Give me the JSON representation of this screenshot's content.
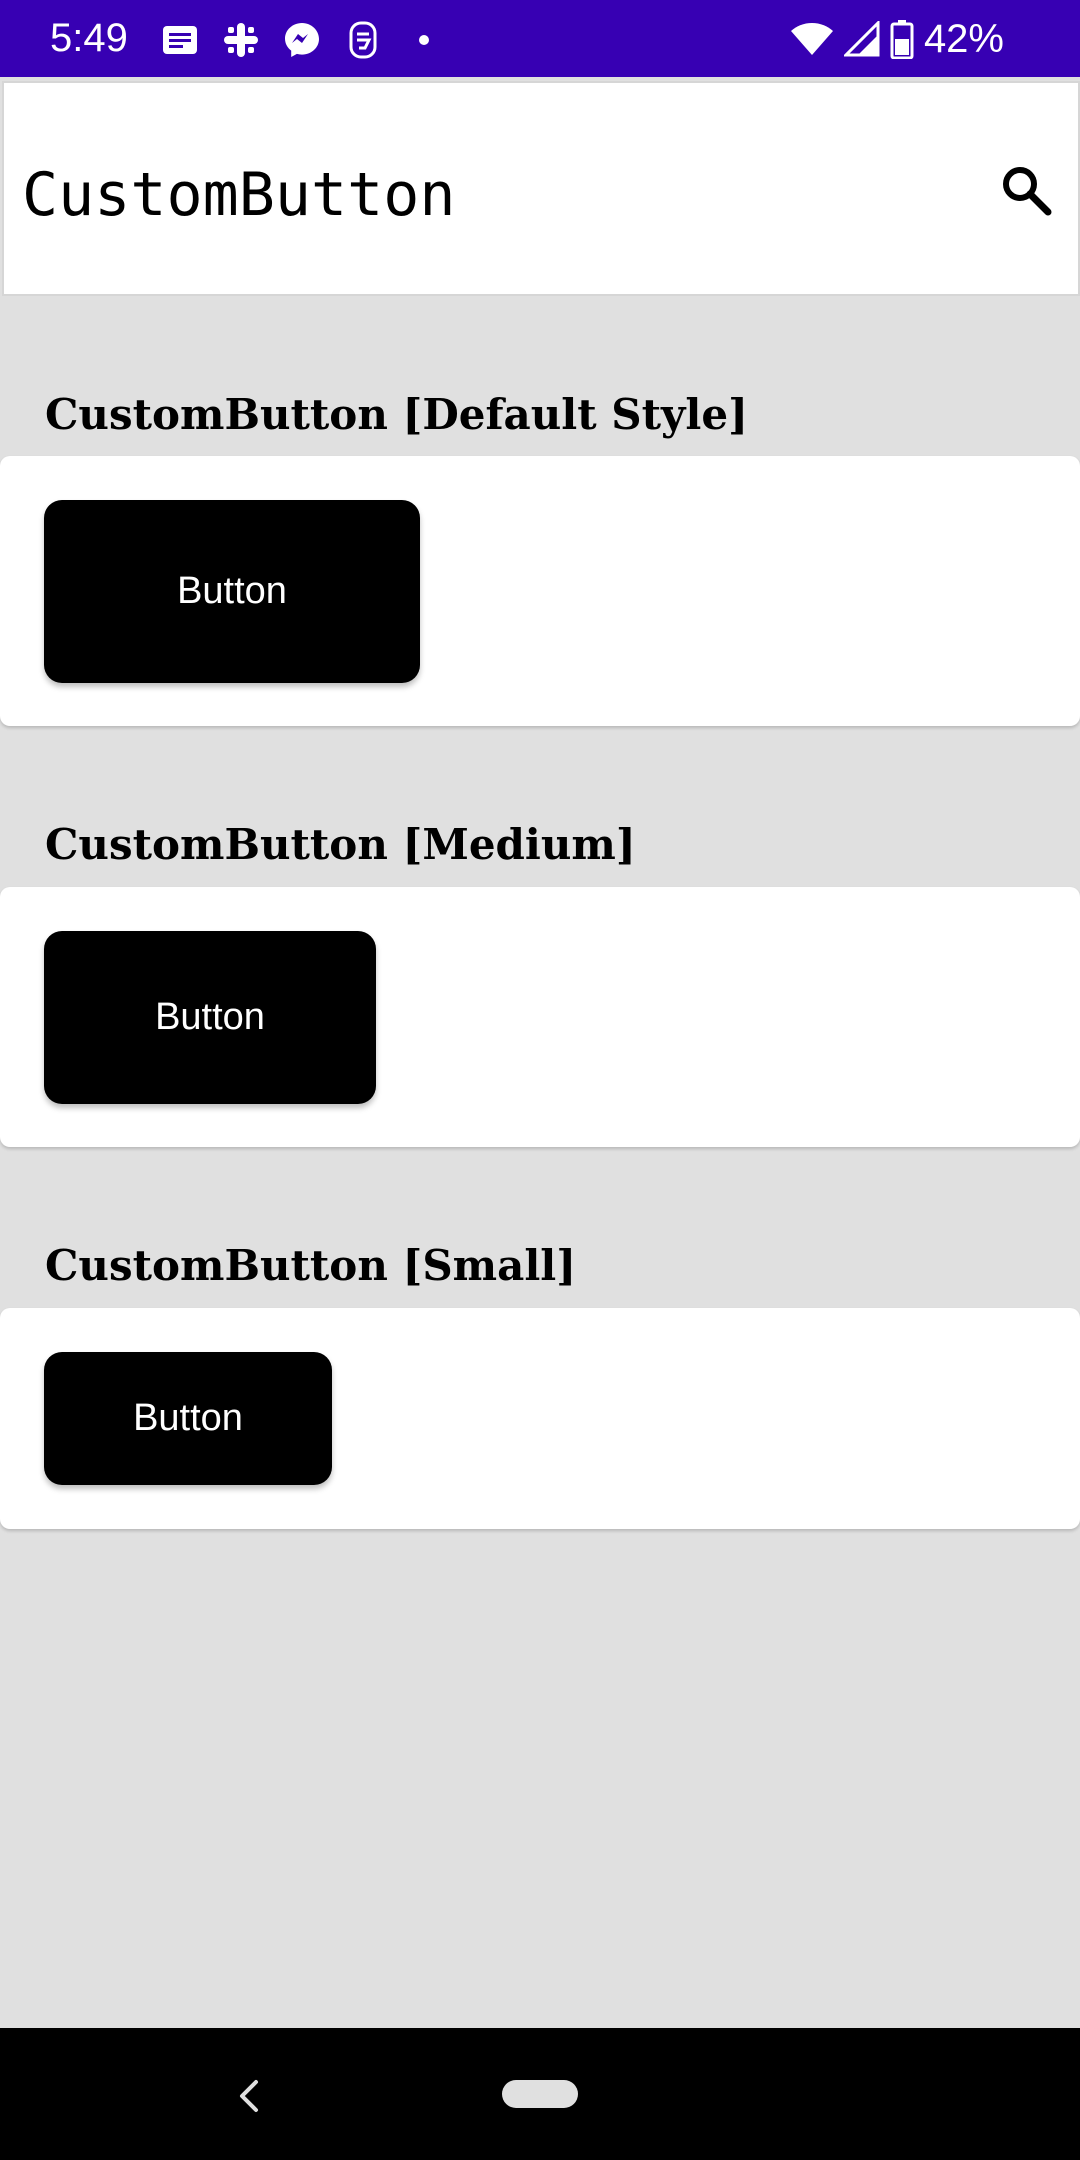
{
  "status_bar": {
    "time": "5:49",
    "battery": "42%",
    "left_icons": [
      "news-icon",
      "slack-icon",
      "messenger-icon",
      "app-icon",
      "dot-icon"
    ],
    "right_icons": [
      "wifi-icon",
      "signal-icon",
      "battery-icon"
    ],
    "background": "#3700b3"
  },
  "app_bar": {
    "title": "CustomButton",
    "search_icon": "search-icon"
  },
  "sections": [
    {
      "title": "CustomButton [Default Style]",
      "button_label": "Button",
      "size": "default"
    },
    {
      "title": "CustomButton [Medium]",
      "button_label": "Button",
      "size": "medium"
    },
    {
      "title": "CustomButton [Small]",
      "button_label": "Button",
      "size": "small"
    }
  ],
  "nav_bar": {
    "back_icon": "back-icon",
    "home_icon": "home-pill-icon"
  },
  "colors": {
    "page_background": "#e0e0e0",
    "button_background": "#000000",
    "button_text": "#ffffff"
  }
}
